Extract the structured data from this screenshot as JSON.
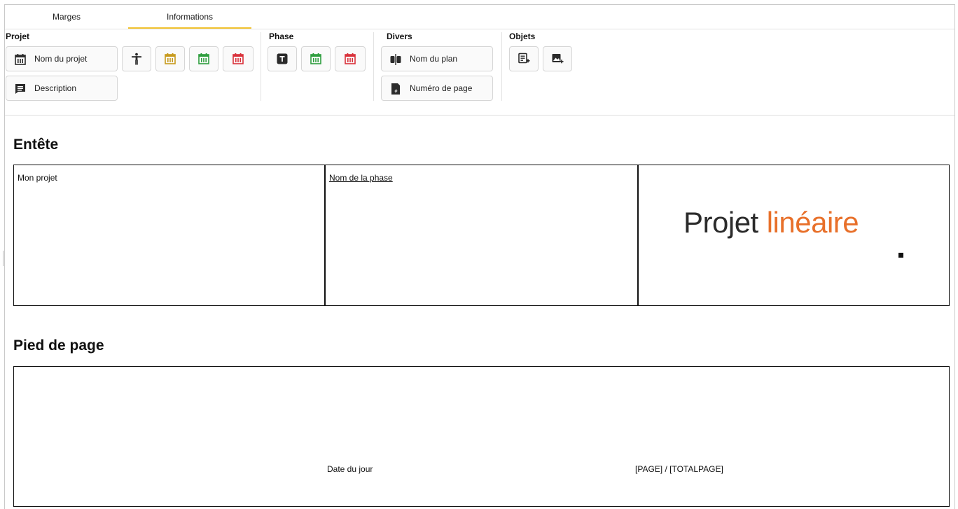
{
  "tabs": [
    {
      "label": "Marges"
    },
    {
      "label": "Informations"
    }
  ],
  "ribbon": {
    "groups": {
      "projet": {
        "title": "Projet",
        "name_button": "Nom du projet",
        "description_button": "Description"
      },
      "phase": {
        "title": "Phase"
      },
      "divers": {
        "title": "Divers",
        "plan_button": "Nom du plan",
        "page_button": "Numéro de page"
      },
      "objets": {
        "title": "Objets"
      }
    },
    "icon_colors": {
      "dark": "#2b2b2b",
      "gold": "#c79a1c",
      "green": "#2e9e3e",
      "red": "#d9313a"
    }
  },
  "header": {
    "title": "Entête",
    "cells": {
      "project": "Mon projet",
      "phase": "Nom de la phase",
      "logo": {
        "part1": "Projet",
        "part2": "linéaire"
      }
    }
  },
  "footer": {
    "title": "Pied de page",
    "date": "Date du jour",
    "page": "[PAGE] / [TOTALPAGE]"
  }
}
